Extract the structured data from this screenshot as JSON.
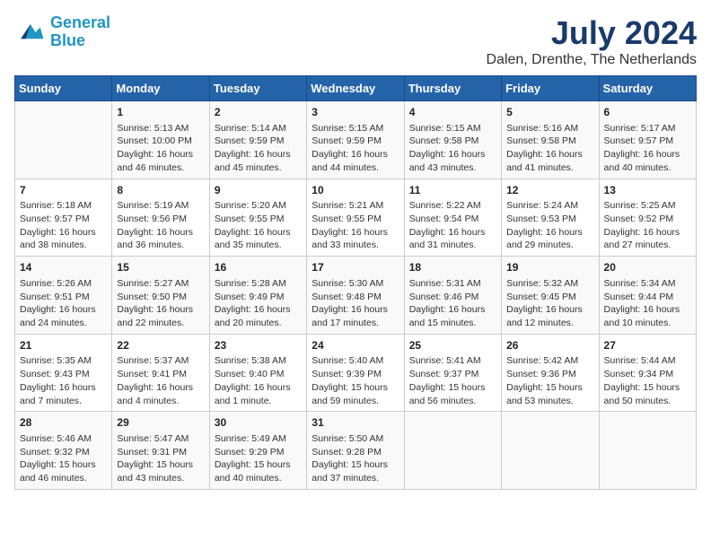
{
  "header": {
    "logo_line1": "General",
    "logo_line2": "Blue",
    "month": "July 2024",
    "location": "Dalen, Drenthe, The Netherlands"
  },
  "weekdays": [
    "Sunday",
    "Monday",
    "Tuesday",
    "Wednesday",
    "Thursday",
    "Friday",
    "Saturday"
  ],
  "weeks": [
    [
      {
        "day": "",
        "info": ""
      },
      {
        "day": "1",
        "info": "Sunrise: 5:13 AM\nSunset: 10:00 PM\nDaylight: 16 hours\nand 46 minutes."
      },
      {
        "day": "2",
        "info": "Sunrise: 5:14 AM\nSunset: 9:59 PM\nDaylight: 16 hours\nand 45 minutes."
      },
      {
        "day": "3",
        "info": "Sunrise: 5:15 AM\nSunset: 9:59 PM\nDaylight: 16 hours\nand 44 minutes."
      },
      {
        "day": "4",
        "info": "Sunrise: 5:15 AM\nSunset: 9:58 PM\nDaylight: 16 hours\nand 43 minutes."
      },
      {
        "day": "5",
        "info": "Sunrise: 5:16 AM\nSunset: 9:58 PM\nDaylight: 16 hours\nand 41 minutes."
      },
      {
        "day": "6",
        "info": "Sunrise: 5:17 AM\nSunset: 9:57 PM\nDaylight: 16 hours\nand 40 minutes."
      }
    ],
    [
      {
        "day": "7",
        "info": "Sunrise: 5:18 AM\nSunset: 9:57 PM\nDaylight: 16 hours\nand 38 minutes."
      },
      {
        "day": "8",
        "info": "Sunrise: 5:19 AM\nSunset: 9:56 PM\nDaylight: 16 hours\nand 36 minutes."
      },
      {
        "day": "9",
        "info": "Sunrise: 5:20 AM\nSunset: 9:55 PM\nDaylight: 16 hours\nand 35 minutes."
      },
      {
        "day": "10",
        "info": "Sunrise: 5:21 AM\nSunset: 9:55 PM\nDaylight: 16 hours\nand 33 minutes."
      },
      {
        "day": "11",
        "info": "Sunrise: 5:22 AM\nSunset: 9:54 PM\nDaylight: 16 hours\nand 31 minutes."
      },
      {
        "day": "12",
        "info": "Sunrise: 5:24 AM\nSunset: 9:53 PM\nDaylight: 16 hours\nand 29 minutes."
      },
      {
        "day": "13",
        "info": "Sunrise: 5:25 AM\nSunset: 9:52 PM\nDaylight: 16 hours\nand 27 minutes."
      }
    ],
    [
      {
        "day": "14",
        "info": "Sunrise: 5:26 AM\nSunset: 9:51 PM\nDaylight: 16 hours\nand 24 minutes."
      },
      {
        "day": "15",
        "info": "Sunrise: 5:27 AM\nSunset: 9:50 PM\nDaylight: 16 hours\nand 22 minutes."
      },
      {
        "day": "16",
        "info": "Sunrise: 5:28 AM\nSunset: 9:49 PM\nDaylight: 16 hours\nand 20 minutes."
      },
      {
        "day": "17",
        "info": "Sunrise: 5:30 AM\nSunset: 9:48 PM\nDaylight: 16 hours\nand 17 minutes."
      },
      {
        "day": "18",
        "info": "Sunrise: 5:31 AM\nSunset: 9:46 PM\nDaylight: 16 hours\nand 15 minutes."
      },
      {
        "day": "19",
        "info": "Sunrise: 5:32 AM\nSunset: 9:45 PM\nDaylight: 16 hours\nand 12 minutes."
      },
      {
        "day": "20",
        "info": "Sunrise: 5:34 AM\nSunset: 9:44 PM\nDaylight: 16 hours\nand 10 minutes."
      }
    ],
    [
      {
        "day": "21",
        "info": "Sunrise: 5:35 AM\nSunset: 9:43 PM\nDaylight: 16 hours\nand 7 minutes."
      },
      {
        "day": "22",
        "info": "Sunrise: 5:37 AM\nSunset: 9:41 PM\nDaylight: 16 hours\nand 4 minutes."
      },
      {
        "day": "23",
        "info": "Sunrise: 5:38 AM\nSunset: 9:40 PM\nDaylight: 16 hours\nand 1 minute."
      },
      {
        "day": "24",
        "info": "Sunrise: 5:40 AM\nSunset: 9:39 PM\nDaylight: 15 hours\nand 59 minutes."
      },
      {
        "day": "25",
        "info": "Sunrise: 5:41 AM\nSunset: 9:37 PM\nDaylight: 15 hours\nand 56 minutes."
      },
      {
        "day": "26",
        "info": "Sunrise: 5:42 AM\nSunset: 9:36 PM\nDaylight: 15 hours\nand 53 minutes."
      },
      {
        "day": "27",
        "info": "Sunrise: 5:44 AM\nSunset: 9:34 PM\nDaylight: 15 hours\nand 50 minutes."
      }
    ],
    [
      {
        "day": "28",
        "info": "Sunrise: 5:46 AM\nSunset: 9:32 PM\nDaylight: 15 hours\nand 46 minutes."
      },
      {
        "day": "29",
        "info": "Sunrise: 5:47 AM\nSunset: 9:31 PM\nDaylight: 15 hours\nand 43 minutes."
      },
      {
        "day": "30",
        "info": "Sunrise: 5:49 AM\nSunset: 9:29 PM\nDaylight: 15 hours\nand 40 minutes."
      },
      {
        "day": "31",
        "info": "Sunrise: 5:50 AM\nSunset: 9:28 PM\nDaylight: 15 hours\nand 37 minutes."
      },
      {
        "day": "",
        "info": ""
      },
      {
        "day": "",
        "info": ""
      },
      {
        "day": "",
        "info": ""
      }
    ]
  ]
}
